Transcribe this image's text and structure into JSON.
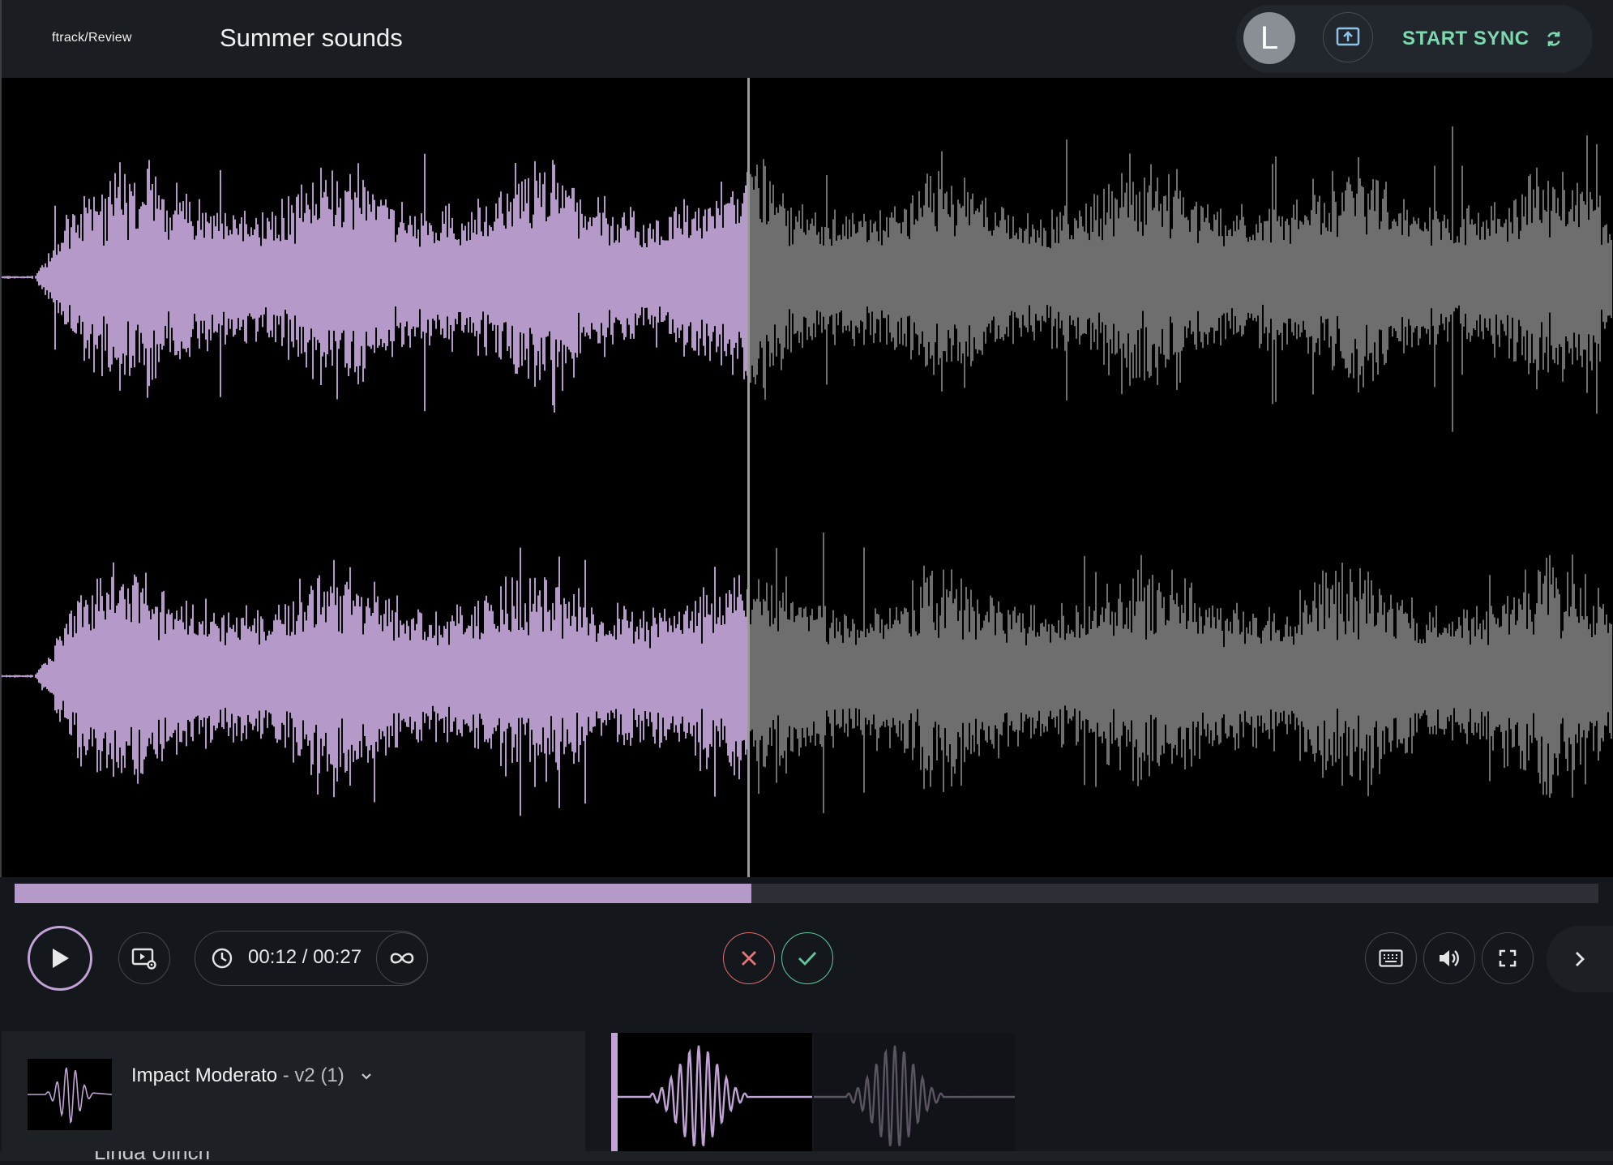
{
  "header": {
    "logo": "ftrack/Review",
    "title": "Summer sounds",
    "avatar_initial": "L",
    "sync_label": "START SYNC",
    "icons": {
      "share": "screen-share-icon",
      "sync": "sync-icon"
    }
  },
  "player": {
    "progress_fraction": 0.465,
    "time_current": "00:12",
    "time_total": "00:27",
    "time_display": "00:12 / 00:27",
    "waveform_colors": {
      "played": "#b59ac9",
      "unplayed": "#6e6e6e"
    },
    "icons": {
      "play": "play-icon",
      "media_settings": "media-settings-icon",
      "clock": "clock-icon",
      "loop": "loop-icon",
      "reject": "reject-icon",
      "approve": "approve-icon",
      "keyboard": "keyboard-icon",
      "volume": "volume-icon",
      "fullscreen": "fullscreen-icon",
      "next": "chevron-right-icon"
    }
  },
  "version": {
    "name": "Impact Moderato",
    "suffix": " - v2 (1)",
    "dropdown_icon": "chevron-down-icon"
  },
  "bottom": {
    "user_name": "Linda Ullrich"
  }
}
